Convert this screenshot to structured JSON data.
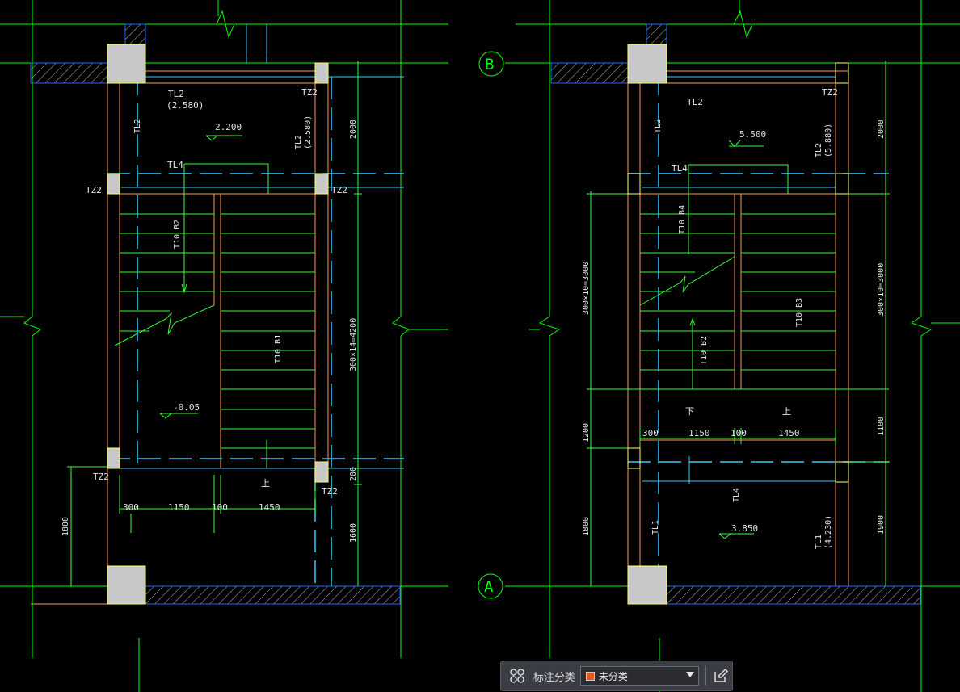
{
  "colors": {
    "background": "#000000",
    "grid": "#00ff00",
    "wall": "#ff9955",
    "stairs": "#33ff33",
    "dashed": "#33ccff",
    "hatch": "#2266ff",
    "column_fill": "#c8c8c8",
    "column_edge": "#ffff66",
    "text": "#e6e6e6",
    "accent": "#e8561a"
  },
  "left_plan": {
    "labels": {
      "tl2_top": "TL2",
      "tl2_top_elev": "(2.580)",
      "tz2_tr": "TZ2",
      "tl2_left": "TL2",
      "tl2_right": "TL2",
      "tl2_right_elev": "(2.580)",
      "tl4": "TL4",
      "tz2_ml": "TZ2",
      "tz2_mr": "TZ2",
      "tz2_bl": "TZ2",
      "tz2_br": "TZ2",
      "tb2": "T10 B2",
      "tb1": "T10 B1",
      "up": "上"
    },
    "elevations": {
      "landing": "2.200",
      "ground": "-0.05"
    },
    "dimensions": {
      "d2000": "2000",
      "d4200": "300×14=4200",
      "d200": "200",
      "d1600": "1600",
      "d1800": "1800",
      "w300": "300",
      "w1150": "1150",
      "w100": "100",
      "w1450": "1450"
    }
  },
  "right_plan": {
    "axis_b": "B",
    "axis_a": "A",
    "labels": {
      "tl2_top": "TL2",
      "tz2_tr": "TZ2",
      "tl2_left": "TL2",
      "tl2_right": "TL2",
      "tl2_right_elev": "(5.880)",
      "tl4_top": "TL4",
      "tb4": "T10 B4",
      "tb3": "T10 B3",
      "tb2": "T10 B2",
      "down": "下",
      "up": "上",
      "tl4_low": "TL4",
      "tl1_left": "TL1",
      "tl1_right": "TL1",
      "tl1_right_elev": "(4.230)"
    },
    "elevations": {
      "landing_top": "5.500",
      "landing_mid": "3.850"
    },
    "dimensions": {
      "left_3000": "300×10=3000",
      "left_1200": "1200",
      "left_1800": "1800",
      "right_2000": "2000",
      "right_3000": "300×10=3000",
      "right_1100": "1100",
      "right_1900": "1900",
      "w300": "300",
      "w1150": "1150",
      "w100": "100",
      "w1450": "1450"
    }
  },
  "toolbar": {
    "grid_icon": "grid-icon",
    "label": "标注分类",
    "selected": "未分类",
    "edit_icon": "edit-icon"
  }
}
